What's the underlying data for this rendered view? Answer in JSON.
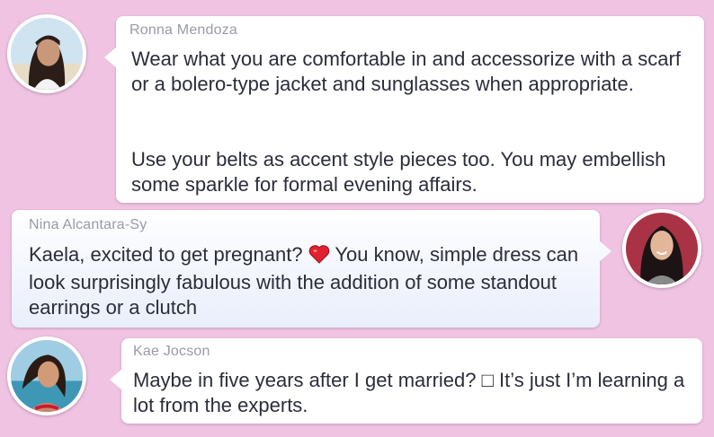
{
  "messages": [
    {
      "author": "Ronna Mendoza",
      "paragraph1": "Wear what you are comfortable in and accessorize with a scarf or a bolero-type jacket and sunglasses when appropriate.",
      "paragraph2": "Use your belts as accent style pieces too. You may embellish some sparkle for formal evening affairs.",
      "avatar_icon": "woman-portrait-beach"
    },
    {
      "author": "Nina Alcantara-Sy",
      "text_before_emoji": "Kaela, excited to get pregnant? ",
      "emoji_icon": "red-heart-emoji",
      "text_after_emoji": " You know, simple dress can look surprisingly fabulous with the addition of some standout earrings or a clutch",
      "avatar_icon": "woman-portrait-red"
    },
    {
      "author": "Kae Jocson",
      "text": "Maybe in five years after I get married? □ It’s just I’m learning a lot  from the experts.",
      "avatar_icon": "woman-portrait-sea"
    }
  ],
  "colors": {
    "background": "#efc3e1",
    "name_text": "#999aa6",
    "body_text": "#2b2d3a",
    "heart": "#e0212f"
  }
}
